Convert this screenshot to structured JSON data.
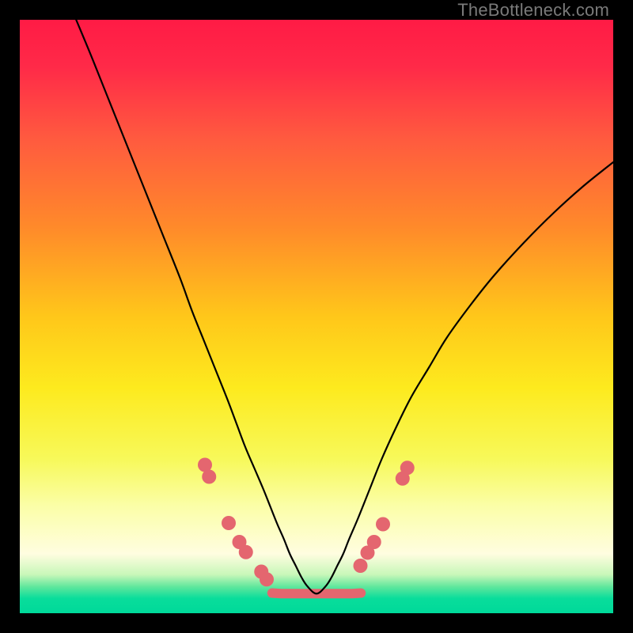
{
  "watermark": "TheBottleneck.com",
  "chart_data": {
    "type": "line",
    "title": "",
    "xlabel": "",
    "ylabel": "",
    "xlim": [
      0,
      100
    ],
    "ylim": [
      0,
      100
    ],
    "background_gradient": {
      "stops": [
        {
          "pos": 0.0,
          "color": "#ff1b45"
        },
        {
          "pos": 0.08,
          "color": "#ff2a48"
        },
        {
          "pos": 0.2,
          "color": "#ff5a3f"
        },
        {
          "pos": 0.35,
          "color": "#ff8a2a"
        },
        {
          "pos": 0.5,
          "color": "#ffc71a"
        },
        {
          "pos": 0.62,
          "color": "#fdea1e"
        },
        {
          "pos": 0.74,
          "color": "#f7f95a"
        },
        {
          "pos": 0.82,
          "color": "#fbfea8"
        },
        {
          "pos": 0.9,
          "color": "#fffde0"
        },
        {
          "pos": 0.935,
          "color": "#c8f7b9"
        },
        {
          "pos": 0.955,
          "color": "#62e79d"
        },
        {
          "pos": 0.975,
          "color": "#09dd9b"
        },
        {
          "pos": 1.0,
          "color": "#00d99a"
        }
      ]
    },
    "series": [
      {
        "name": "bottleneck-curve",
        "color": "#000000",
        "stroke_width": 2.2,
        "x": [
          9.5,
          12,
          15,
          18,
          21,
          24,
          27,
          29,
          31,
          33,
          35,
          36.5,
          38,
          39.5,
          41,
          42.2,
          43.4,
          44.5,
          45.5,
          46.5,
          47.5,
          48.5,
          50,
          51.5,
          52.5,
          53.5,
          54.5,
          55.5,
          57,
          59,
          61,
          63.5,
          66,
          69,
          72,
          76,
          80,
          85,
          90,
          95,
          100
        ],
        "y": [
          100,
          94,
          86.5,
          79,
          71.5,
          64,
          56.5,
          51,
          46,
          41,
          36,
          32,
          28,
          24.5,
          21,
          18,
          15,
          12.5,
          10,
          8,
          6,
          4.5,
          3.3,
          4.5,
          6,
          8,
          10,
          12.5,
          16,
          21,
          26,
          31.5,
          36.5,
          41.5,
          46.5,
          52,
          57,
          62.5,
          67.5,
          72,
          76
        ]
      }
    ],
    "green_band": {
      "name": "optimal-band",
      "color": "#e4666f",
      "x": [
        42.5,
        44,
        45.5,
        47,
        48.5,
        50,
        51.5,
        53,
        54.5,
        56,
        57.5
      ],
      "y": [
        3.4,
        3.3,
        3.3,
        3.3,
        3.3,
        3.3,
        3.3,
        3.3,
        3.3,
        3.3,
        3.4
      ],
      "stroke_width": 12
    },
    "markers": {
      "name": "sample-markers",
      "color": "#e4666f",
      "radius": 9,
      "points": [
        {
          "x": 31.2,
          "y": 25.0
        },
        {
          "x": 31.9,
          "y": 23.0
        },
        {
          "x": 35.2,
          "y": 15.2
        },
        {
          "x": 37.0,
          "y": 12.0
        },
        {
          "x": 38.1,
          "y": 10.3
        },
        {
          "x": 40.7,
          "y": 7.0
        },
        {
          "x": 41.6,
          "y": 5.7
        },
        {
          "x": 57.4,
          "y": 8.0
        },
        {
          "x": 58.6,
          "y": 10.2
        },
        {
          "x": 59.7,
          "y": 12.0
        },
        {
          "x": 61.2,
          "y": 15.0
        },
        {
          "x": 64.5,
          "y": 22.7
        },
        {
          "x": 65.3,
          "y": 24.5
        }
      ]
    }
  }
}
